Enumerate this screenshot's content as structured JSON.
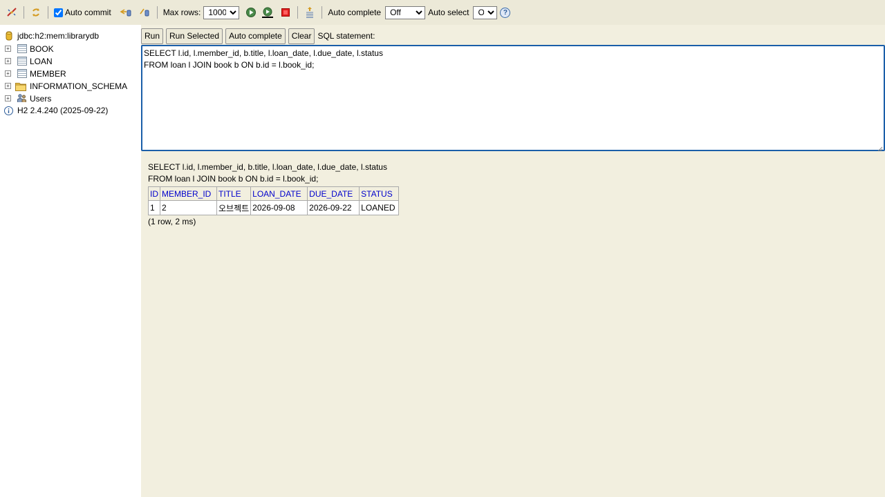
{
  "toolbar": {
    "auto_commit_label": "Auto commit",
    "max_rows_label": "Max rows:",
    "max_rows_value": "1000",
    "auto_complete_label": "Auto complete",
    "auto_complete_value": "Off",
    "auto_select_label": "Auto select",
    "auto_select_value": "On",
    "help_symbol": "?"
  },
  "tree": {
    "connection": "jdbc:h2:mem:librarydb",
    "items": [
      {
        "label": "BOOK",
        "icon": "table-icon"
      },
      {
        "label": "LOAN",
        "icon": "table-icon"
      },
      {
        "label": "MEMBER",
        "icon": "table-icon"
      },
      {
        "label": "INFORMATION_SCHEMA",
        "icon": "folder-icon"
      },
      {
        "label": "Users",
        "icon": "users-icon"
      }
    ],
    "version": "H2 2.4.240 (2025-09-22)"
  },
  "buttons": {
    "run": "Run",
    "run_selected": "Run Selected",
    "auto_complete": "Auto complete",
    "clear": "Clear",
    "sql_label": "SQL statement:"
  },
  "editor": {
    "lines": [
      "SELECT l.id, l.member_id, b.title, l.loan_date, l.due_date, l.status",
      "FROM loan l JOIN book b ON b.id = l.book_id;"
    ]
  },
  "result": {
    "query_lines": [
      "SELECT l.id, l.member_id, b.title, l.loan_date, l.due_date, l.status",
      "FROM loan l JOIN book b ON b.id = l.book_id;"
    ],
    "columns": [
      "ID",
      "MEMBER_ID",
      "TITLE",
      "LOAN_DATE",
      "DUE_DATE",
      "STATUS"
    ],
    "rows": [
      [
        "1",
        "2",
        "오브젝트",
        "2026-09-08",
        "2026-09-22",
        "LOANED"
      ]
    ],
    "row_count": "(1 row, 2 ms)"
  },
  "colors": {
    "toolbar_bg": "#ece9d8",
    "panel_bg": "#f2efdf",
    "editor_border": "#1a5ea8",
    "header_text": "#0000cc"
  }
}
